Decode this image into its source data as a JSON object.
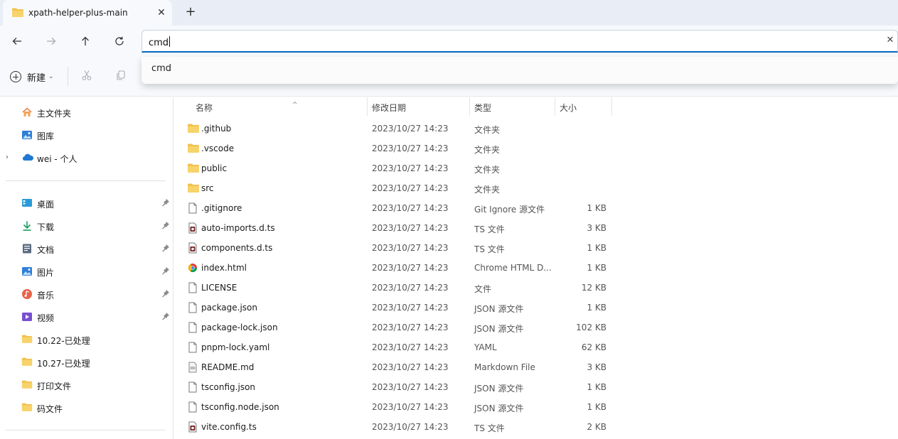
{
  "tab": {
    "title": "xpath-helper-plus-main",
    "close": "✕",
    "new": "+"
  },
  "address": {
    "value": "cmd",
    "clear": "✕"
  },
  "suggestion": "cmd",
  "toolbar": {
    "new_label": "新建",
    "new_chevron": "⌄",
    "cut_icon": "cut-icon",
    "copy_icon": "copy-icon"
  },
  "colors": {
    "accent": "#0067c0",
    "folder": "#f2c14e",
    "chrome_bg": "#f7f9fc",
    "tab_bg": "#e9eef6"
  },
  "sidebar": {
    "top": [
      {
        "label": "主文件夹",
        "icon": "home-icon"
      },
      {
        "label": "图库",
        "icon": "gallery-icon"
      },
      {
        "label": "wei - 个人",
        "icon": "onedrive-cloud-icon",
        "expand": "›"
      }
    ],
    "pinned": [
      {
        "label": "桌面",
        "icon": "desktop-icon"
      },
      {
        "label": "下载",
        "icon": "download-icon"
      },
      {
        "label": "文档",
        "icon": "documents-icon"
      },
      {
        "label": "图片",
        "icon": "pictures-icon"
      },
      {
        "label": "音乐",
        "icon": "music-icon"
      },
      {
        "label": "视频",
        "icon": "videos-icon"
      }
    ],
    "folders": [
      {
        "label": "10.22-已处理"
      },
      {
        "label": "10.27-已处理"
      },
      {
        "label": "打印文件"
      },
      {
        "label": "码文件"
      }
    ]
  },
  "columns": {
    "name": "名称",
    "date": "修改日期",
    "type": "类型",
    "size": "大小",
    "sort_arrow": "^"
  },
  "files": [
    {
      "name": ".github",
      "date": "2023/10/27 14:23",
      "type": "文件夹",
      "size": "",
      "icon": "folder-icon"
    },
    {
      "name": ".vscode",
      "date": "2023/10/27 14:23",
      "type": "文件夹",
      "size": "",
      "icon": "folder-icon"
    },
    {
      "name": "public",
      "date": "2023/10/27 14:23",
      "type": "文件夹",
      "size": "",
      "icon": "folder-icon"
    },
    {
      "name": "src",
      "date": "2023/10/27 14:23",
      "type": "文件夹",
      "size": "",
      "icon": "folder-icon"
    },
    {
      "name": ".gitignore",
      "date": "2023/10/27 14:23",
      "type": "Git Ignore 源文件",
      "size": "1 KB",
      "icon": "file-icon"
    },
    {
      "name": "auto-imports.d.ts",
      "date": "2023/10/27 14:23",
      "type": "TS 文件",
      "size": "3 KB",
      "icon": "ts-file-icon"
    },
    {
      "name": "components.d.ts",
      "date": "2023/10/27 14:23",
      "type": "TS 文件",
      "size": "1 KB",
      "icon": "ts-file-icon"
    },
    {
      "name": "index.html",
      "date": "2023/10/27 14:23",
      "type": "Chrome HTML D...",
      "size": "1 KB",
      "icon": "chrome-html-icon"
    },
    {
      "name": "LICENSE",
      "date": "2023/10/27 14:23",
      "type": "文件",
      "size": "12 KB",
      "icon": "file-icon"
    },
    {
      "name": "package.json",
      "date": "2023/10/27 14:23",
      "type": "JSON 源文件",
      "size": "1 KB",
      "icon": "file-icon"
    },
    {
      "name": "package-lock.json",
      "date": "2023/10/27 14:23",
      "type": "JSON 源文件",
      "size": "102 KB",
      "icon": "file-icon"
    },
    {
      "name": "pnpm-lock.yaml",
      "date": "2023/10/27 14:23",
      "type": "YAML",
      "size": "62 KB",
      "icon": "file-icon"
    },
    {
      "name": "README.md",
      "date": "2023/10/27 14:23",
      "type": "Markdown File",
      "size": "3 KB",
      "icon": "markdown-file-icon"
    },
    {
      "name": "tsconfig.json",
      "date": "2023/10/27 14:23",
      "type": "JSON 源文件",
      "size": "1 KB",
      "icon": "file-icon"
    },
    {
      "name": "tsconfig.node.json",
      "date": "2023/10/27 14:23",
      "type": "JSON 源文件",
      "size": "1 KB",
      "icon": "file-icon"
    },
    {
      "name": "vite.config.ts",
      "date": "2023/10/27 14:23",
      "type": "TS 文件",
      "size": "2 KB",
      "icon": "ts-file-icon"
    }
  ]
}
